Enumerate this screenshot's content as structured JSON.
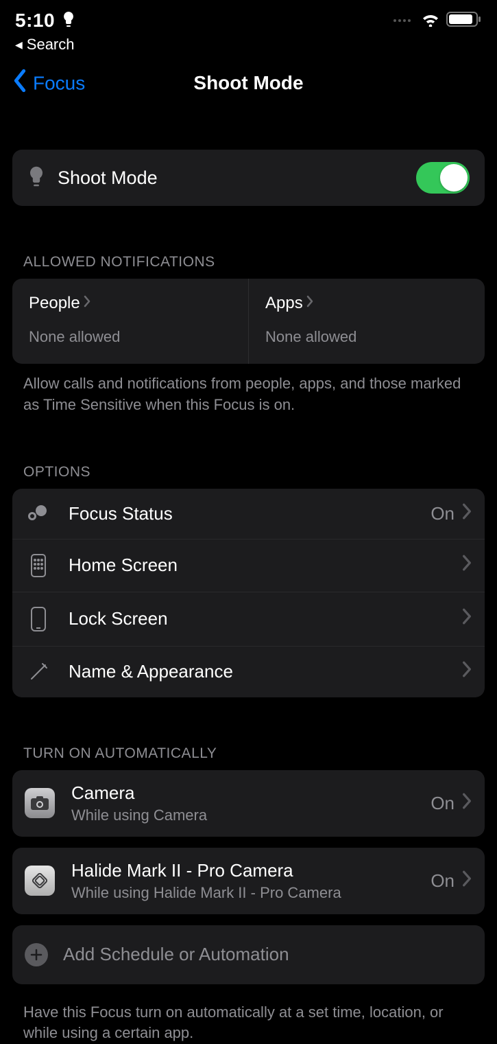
{
  "status": {
    "time": "5:10"
  },
  "breadcrumb": {
    "label": "Search"
  },
  "nav": {
    "back": "Focus",
    "title": "Shoot Mode"
  },
  "main_toggle": {
    "label": "Shoot Mode",
    "on": true
  },
  "allowed": {
    "header": "ALLOWED NOTIFICATIONS",
    "people": {
      "title": "People",
      "sub": "None allowed"
    },
    "apps": {
      "title": "Apps",
      "sub": "None allowed"
    },
    "footer": "Allow calls and notifications from people, apps, and those marked as Time Sensitive when this Focus is on."
  },
  "options": {
    "header": "OPTIONS",
    "items": [
      {
        "label": "Focus Status",
        "value": "On"
      },
      {
        "label": "Home Screen",
        "value": ""
      },
      {
        "label": "Lock Screen",
        "value": ""
      },
      {
        "label": "Name & Appearance",
        "value": ""
      }
    ]
  },
  "automation": {
    "header": "TURN ON AUTOMATICALLY",
    "items": [
      {
        "title": "Camera",
        "sub": "While using Camera",
        "value": "On"
      },
      {
        "title": "Halide Mark II - Pro Camera",
        "sub": "While using Halide Mark II - Pro Camera",
        "value": "On"
      }
    ],
    "add_label": "Add Schedule or Automation",
    "footer": "Have this Focus turn on automatically at a set time, location, or while using a certain app."
  }
}
